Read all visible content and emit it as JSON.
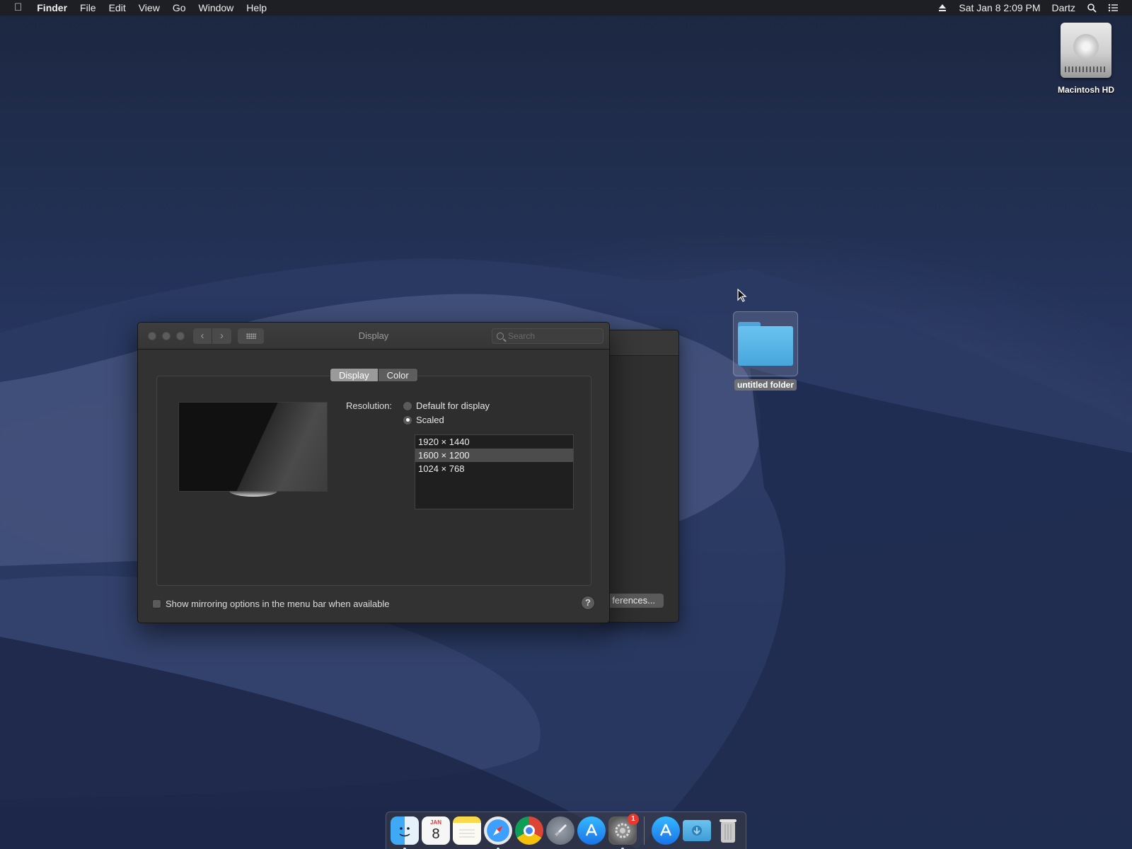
{
  "menubar": {
    "app_name": "Finder",
    "menus": [
      "File",
      "Edit",
      "View",
      "Go",
      "Window",
      "Help"
    ],
    "datetime": "Sat Jan 8  2:09 PM",
    "user": "Dartz"
  },
  "desktop": {
    "hard_drive_label": "Macintosh HD",
    "folder_label": "untitled folder"
  },
  "back_window": {
    "button_label": "ferences..."
  },
  "window": {
    "title": "Display",
    "search_placeholder": "Search",
    "tabs": [
      "Display",
      "Color"
    ],
    "active_tab": "Display",
    "resolution_label": "Resolution:",
    "options": [
      "Default for display",
      "Scaled"
    ],
    "selected_option": "Scaled",
    "resolutions": [
      "1920 × 1440",
      "1600 × 1200",
      "1024 × 768"
    ],
    "selected_resolution": "1600 × 1200",
    "mirroring_label": "Show mirroring options in the menu bar when available",
    "mirroring_checked": false,
    "help_label": "?"
  },
  "dock": {
    "apps": [
      "finder-icon",
      "calendar-icon",
      "notes-icon",
      "safari-icon",
      "chrome-icon",
      "launchpad-icon",
      "app-store-icon",
      "system-preferences-icon",
      "app-store-icon-2",
      "downloads-folder-icon",
      "trash-icon"
    ],
    "calendar_day": "8",
    "calendar_month": "JAN",
    "system_preferences_badge": "1"
  }
}
